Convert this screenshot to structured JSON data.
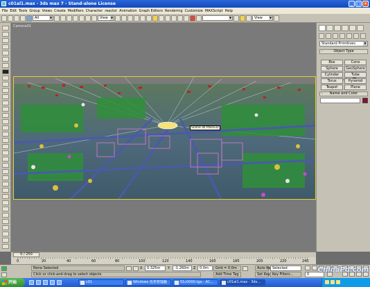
{
  "window": {
    "title": "c01al1.max - 3ds max 7 - Stand-alone License"
  },
  "menu": [
    "File",
    "Edit",
    "Tools",
    "Group",
    "Views",
    "Create",
    "Modifiers",
    "Character",
    "reactor",
    "Animation",
    "Graph Editors",
    "Rendering",
    "Customize",
    "MAXScript",
    "Help"
  ],
  "toolbar": {
    "selection_filter": "All",
    "ref_coord": "View",
    "named_selection": "",
    "view_dropdown": "View"
  },
  "viewport": {
    "label": "Camera01",
    "tooltip": "Scene all Plane32"
  },
  "command_panel": {
    "category": "Standard Primitives",
    "object_type_title": "Object Type",
    "autogrid_label": "AutoGrid",
    "primitives": [
      "Box",
      "Cone",
      "Sphere",
      "GeoSphere",
      "Cylinder",
      "Tube",
      "Torus",
      "Pyramid",
      "Teapot",
      "Plane"
    ],
    "name_color_title": "Name and Color",
    "color": "#8b0f2e"
  },
  "time_slider": {
    "frame": "0 / 250"
  },
  "track": {
    "ticks": [
      "0",
      "20",
      "40",
      "60",
      "80",
      "100",
      "120",
      "140",
      "160",
      "180",
      "200",
      "220",
      "240"
    ]
  },
  "status": {
    "selection": "None Selected",
    "prompt": "Click or click-and-drag to select objects",
    "x_label": "X",
    "x_value": "0.325m",
    "y_label": "Y",
    "y_value": "-1.260m",
    "z_label": "Z",
    "z_value": "0.0m",
    "grid": "Grid = 0.0m",
    "add_time_tag": "Add Time Tag",
    "auto_key": "Auto Key",
    "set_key": "Set Key",
    "key_mode": "Selected",
    "key_filters": "Key Filters...",
    "frame_value": "0"
  },
  "taskbar": {
    "start": "开始",
    "tasks": [
      "c01",
      "Windows 任务管理器",
      "01c0000.tga - AC...",
      "c01al1.max - 3ds..."
    ],
    "clock": "",
    "watermark": "ChinaPd.com"
  }
}
